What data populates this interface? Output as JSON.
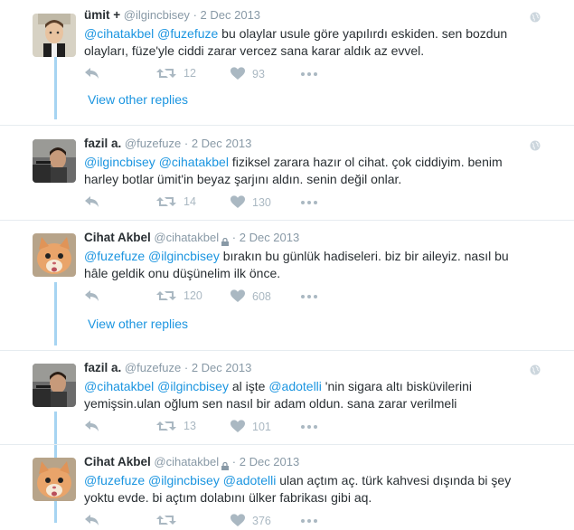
{
  "tweets": [
    {
      "fullname": "ümit +",
      "handle": "@ilgincbisey",
      "sep": "·",
      "time": "2 Dec 2013",
      "protected": false,
      "text": [
        {
          "t": "@cihatakbel",
          "m": true
        },
        {
          "t": " ",
          "m": false
        },
        {
          "t": "@fuzefuze",
          "m": true
        },
        {
          "t": " bu olaylar usule göre yapılırdı eskiden. sen bozdun olayları, füze'yle ciddi zarar vercez sana karar aldık az evvel.",
          "m": false
        }
      ],
      "retweets": "12",
      "likes": "93",
      "avatar": "child"
    },
    {
      "fullname": "fazil a.",
      "handle": "@fuzefuze",
      "sep": "·",
      "time": "2 Dec 2013",
      "protected": false,
      "text": [
        {
          "t": "@ilgincbisey",
          "m": true
        },
        {
          "t": " ",
          "m": false
        },
        {
          "t": "@cihatakbel",
          "m": true
        },
        {
          "t": " fiziksel zarara hazır ol cihat. çok ciddiyim. benim harley botlar ümit'in beyaz şarjını aldın. senin değil onlar.",
          "m": false
        }
      ],
      "retweets": "14",
      "likes": "130",
      "avatar": "man"
    },
    {
      "fullname": "Cihat Akbel",
      "handle": "@cihatakbel",
      "sep": "·",
      "time": "2 Dec 2013",
      "protected": true,
      "text": [
        {
          "t": "@fuzefuze",
          "m": true
        },
        {
          "t": " ",
          "m": false
        },
        {
          "t": "@ilgincbisey",
          "m": true
        },
        {
          "t": " bırakın bu günlük hadiseleri. biz bir aileyiz. nasıl bu hâle geldik onu düşünelim ilk önce.",
          "m": false
        }
      ],
      "retweets": "120",
      "likes": "608",
      "avatar": "cat"
    },
    {
      "fullname": "fazil a.",
      "handle": "@fuzefuze",
      "sep": "·",
      "time": "2 Dec 2013",
      "protected": false,
      "text": [
        {
          "t": "@cihatakbel",
          "m": true
        },
        {
          "t": " ",
          "m": false
        },
        {
          "t": "@ilgincbisey",
          "m": true
        },
        {
          "t": " al işte ",
          "m": false
        },
        {
          "t": "@adotelli",
          "m": true
        },
        {
          "t": " 'nin sigara altı bisküvilerini yemişsin.ulan oğlum sen nasıl bir adam oldun. sana zarar verilmeli",
          "m": false
        }
      ],
      "retweets": "13",
      "likes": "101",
      "avatar": "man"
    },
    {
      "fullname": "Cihat Akbel",
      "handle": "@cihatakbel",
      "sep": "·",
      "time": "2 Dec 2013",
      "protected": true,
      "text": [
        {
          "t": "@fuzefuze",
          "m": true
        },
        {
          "t": " ",
          "m": false
        },
        {
          "t": "@ilgincbisey",
          "m": true
        },
        {
          "t": " ",
          "m": false
        },
        {
          "t": "@adotelli",
          "m": true
        },
        {
          "t": " ulan açtım aç. türk kahvesi dışında bi şey yoktu evde. bi açtım dolabını ülker fabrikası gibi aq.",
          "m": false
        }
      ],
      "retweets": "",
      "likes": "376",
      "avatar": "cat"
    }
  ],
  "view_other_replies": "View other replies",
  "colors": {
    "link": "#1b95e0",
    "muted": "#aab8c2",
    "thread": "#a6d4f2"
  },
  "icons": [
    "reply-icon",
    "retweet-icon",
    "heart-icon",
    "more-icon",
    "globe-icon",
    "lock-icon"
  ]
}
